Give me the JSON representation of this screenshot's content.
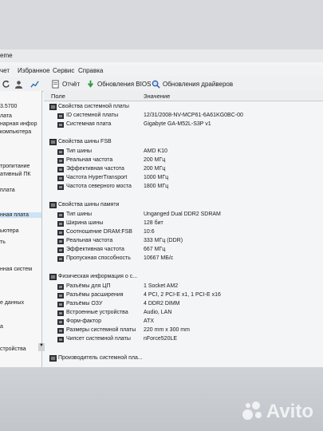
{
  "window": {
    "title_fragment": "eme"
  },
  "menu": [
    "чет",
    "Избранное",
    "Сервис",
    "Справка"
  ],
  "toolbar": {
    "report": "Отчёт",
    "bios_update": "Обновления BIOS",
    "driver_update": "Обновления драйверов"
  },
  "sidebar": [
    "3.5700",
    "лата",
    "нарная инфор",
    "компьютера",
    "тропитание",
    "ативный ПК",
    "плата",
    "нная плата",
    "ьютера",
    "ть",
    "нная систем",
    "е данных",
    "а",
    "стройства"
  ],
  "columns": {
    "field": "Поле",
    "value": "Значение"
  },
  "groups": [
    {
      "title": "Свойства системной платы",
      "rows": [
        {
          "field": "ID системной платы",
          "value": "12/31/2008-NV-MCP61-6A61KG0BC-00"
        },
        {
          "field": "Системная плата",
          "value": "Gigabyte GA-M52L-S3P v1"
        }
      ]
    },
    {
      "title": "Свойства шины FSB",
      "rows": [
        {
          "field": "Тип шины",
          "value": "AMD K10"
        },
        {
          "field": "Реальная частота",
          "value": "200 МГц"
        },
        {
          "field": "Эффективная частота",
          "value": "200 МГц"
        },
        {
          "field": "Частота HyperTransport",
          "value": "1000 МГц"
        },
        {
          "field": "Частота северного моста",
          "value": "1800 МГц"
        }
      ]
    },
    {
      "title": "Свойства шины памяти",
      "rows": [
        {
          "field": "Тип шины",
          "value": "Unganged Dual DDR2 SDRAM"
        },
        {
          "field": "Ширина шины",
          "value": "128 бит"
        },
        {
          "field": "Соотношение DRAM:FSB",
          "value": "10:6"
        },
        {
          "field": "Реальная частота",
          "value": "333 МГц (DDR)"
        },
        {
          "field": "Эффективная частота",
          "value": "667 МГц"
        },
        {
          "field": "Пропускная способность",
          "value": "10667 МБ/с"
        }
      ]
    },
    {
      "title": "Физическая информация о с...",
      "rows": [
        {
          "field": "Разъёмы для ЦП",
          "value": "1 Socket AM2"
        },
        {
          "field": "Разъёмы расширения",
          "value": "4 PCI, 2 PCI-E x1, 1 PCI-E x16"
        },
        {
          "field": "Разъёмы ОЗУ",
          "value": "4 DDR2 DIMM"
        },
        {
          "field": "Встроенные устройства",
          "value": "Audio, LAN"
        },
        {
          "field": "Форм-фактор",
          "value": "ATX"
        },
        {
          "field": "Размеры системной платы",
          "value": "220 mm x 300 mm"
        },
        {
          "field": "Чипсет системной платы",
          "value": "nForce520LE"
        }
      ]
    },
    {
      "title": "Производитель системной пла...",
      "rows": []
    }
  ],
  "watermark": "Avito"
}
